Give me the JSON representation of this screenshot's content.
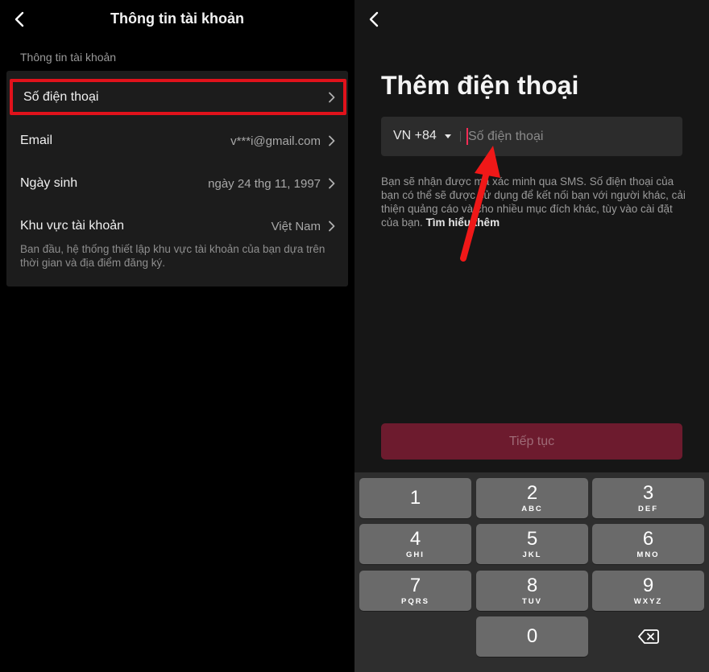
{
  "left": {
    "title": "Thông tin tài khoản",
    "section_label": "Thông tin tài khoản",
    "rows": [
      {
        "label": "Số điện thoại",
        "value": ""
      },
      {
        "label": "Email",
        "value": "v***i@gmail.com"
      },
      {
        "label": "Ngày sinh",
        "value": "ngày 24 thg 11, 1997"
      },
      {
        "label": "Khu vực tài khoản",
        "value": "Việt Nam"
      }
    ],
    "region_note": "Ban đầu, hệ thống thiết lập khu vực tài khoản của bạn dựa trên thời gian và địa điểm đăng ký."
  },
  "right": {
    "title": "Thêm điện thoại",
    "country_code": "VN +84",
    "phone_placeholder": "Số điện thoại",
    "sms_info": "Bạn sẽ nhận được mã xác minh qua SMS. Số điện thoại của bạn có thể sẽ được sử dụng để kết nối bạn với người khác, cải thiện quảng cáo và cho nhiều mục đích khác, tùy vào cài đặt của bạn.",
    "learn_more": "Tìm hiểu thêm",
    "continue_label": "Tiếp tục"
  },
  "keypad": {
    "keys": [
      {
        "num": "1",
        "letters": ""
      },
      {
        "num": "2",
        "letters": "ABC"
      },
      {
        "num": "3",
        "letters": "DEF"
      },
      {
        "num": "4",
        "letters": "GHI"
      },
      {
        "num": "5",
        "letters": "JKL"
      },
      {
        "num": "6",
        "letters": "MNO"
      },
      {
        "num": "7",
        "letters": "PQRS"
      },
      {
        "num": "8",
        "letters": "TUV"
      },
      {
        "num": "9",
        "letters": "WXYZ"
      },
      {
        "num": "0",
        "letters": ""
      }
    ]
  },
  "colors": {
    "highlight": "#e0121b",
    "cursor": "#fe2c55",
    "button_disabled": "#6d1b2e",
    "arrow": "#f01818"
  },
  "icons": {
    "back": "chevron-left-icon",
    "row_chevron": "chevron-right-icon",
    "dropdown": "caret-down-icon",
    "delete": "backspace-icon"
  }
}
